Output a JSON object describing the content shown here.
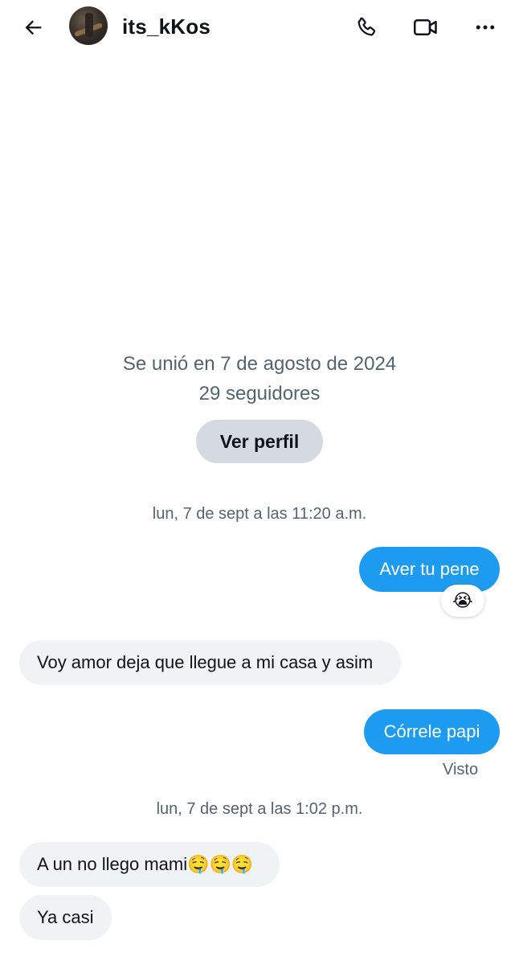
{
  "header": {
    "username": "its_kKos",
    "back_icon": "arrow-left-icon",
    "call_icon": "phone-icon",
    "video_icon": "video-camera-icon",
    "more_icon": "more-horizontal-icon"
  },
  "profile_info": {
    "joined": "Se unió en 7 de agosto de 2024",
    "followers": "29 seguidores",
    "view_profile_label": "Ver perfil"
  },
  "conversation": {
    "timestamp_1": "lun, 7 de sept a las 11:20 a.m.",
    "timestamp_2": "lun, 7 de sept a las 1:02 p.m.",
    "messages": [
      {
        "sender": "me",
        "text": "Aver tu pene"
      },
      {
        "sender": "them",
        "text": "Voy amor deja que llegue a mi casa y asim"
      },
      {
        "sender": "me",
        "text": "Córrele papi"
      },
      {
        "sender": "them",
        "text": "A un no llego mami🤤🤤🤤"
      },
      {
        "sender": "them",
        "text": "Ya casi"
      }
    ],
    "reaction": "😭",
    "seen_label": "Visto"
  },
  "colors": {
    "accent": "#1d9bf0",
    "incoming_bubble": "#eff3f4",
    "secondary_text": "#536471",
    "button_bg": "#d4dadf"
  }
}
